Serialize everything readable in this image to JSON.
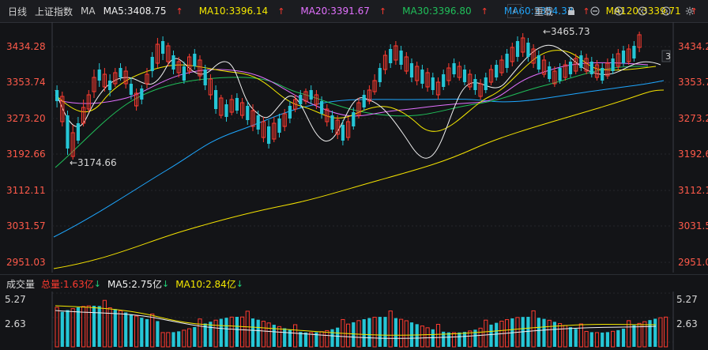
{
  "topbar": {
    "period": "日线",
    "index": "上证指数",
    "ma_label": "MA",
    "ma": [
      {
        "label": "MA5:3408.75",
        "color": "#f2f2f2"
      },
      {
        "label": "MA10:3396.14",
        "color": "#f4e800"
      },
      {
        "label": "MA20:3391.67",
        "color": "#e371ff"
      },
      {
        "label": "MA30:3396.80",
        "color": "#20c05a"
      },
      {
        "label": "MA60:3354.33",
        "color": "#1ea7ff"
      },
      {
        "label": "MA120:3339.71",
        "color": "#f4e200"
      }
    ],
    "ma_arrows": [
      "up",
      "up",
      "up",
      "up",
      "up",
      "up"
    ],
    "restore_label": "重载"
  },
  "price_axis": {
    "left_ticks": [
      "3434.28",
      "3353.74",
      "3273.20",
      "3192.66",
      "3112.11",
      "3031.57",
      "2951.03"
    ],
    "right_ticks": [
      "3434.2",
      "3353.7",
      "3273.2",
      "3192.6",
      "3112.1",
      "3031.5",
      "2951.0"
    ],
    "high_label": "←3465.73",
    "low_label": "←3174.66",
    "last_marker": "3"
  },
  "volume": {
    "label": "成交量",
    "total": "总量:1.63亿",
    "ma5": "MA5:2.75亿",
    "ma10": "MA10:2.84亿",
    "ticks": [
      "5.27",
      "2.63"
    ],
    "right_ticks": [
      "5.27",
      "2.63"
    ]
  },
  "colors": {
    "up": "#ff3b30",
    "down": "#25c6d6",
    "ma5": "#f2f2f2",
    "ma10": "#f4e800",
    "ma20": "#e371ff",
    "ma30": "#20c05a",
    "ma60": "#1ea7ff",
    "ma120": "#f4e200"
  }
}
